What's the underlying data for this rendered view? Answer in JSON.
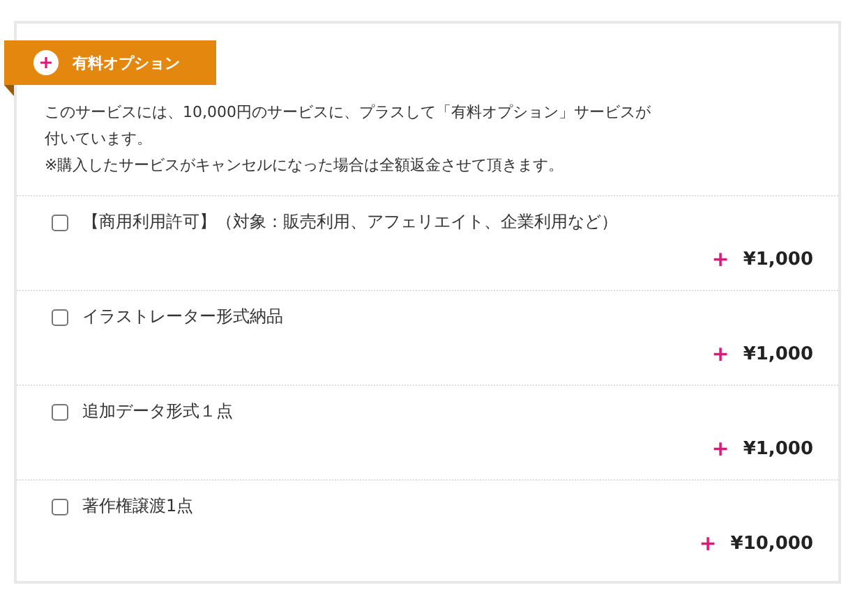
{
  "header": {
    "title": "有料オプション"
  },
  "description": [
    "このサービスには、10,000円のサービスに、プラスして「有料オプション」サービスが",
    "付いています。",
    "※購入したサービスがキャンセルになった場合は全額返金させて頂きます。"
  ],
  "options": [
    {
      "label": "【商用利用許可】（対象：販売利用、アフェリエイト、企業利用など）",
      "checked": false,
      "sign": "+",
      "price": "¥1,000"
    },
    {
      "label": "イラストレーター形式納品",
      "checked": false,
      "sign": "+",
      "price": "¥1,000"
    },
    {
      "label": "追加データ形式１点",
      "checked": false,
      "sign": "+",
      "price": "¥1,000"
    },
    {
      "label": "著作権譲渡1点",
      "checked": false,
      "sign": "+",
      "price": "¥10,000"
    }
  ]
}
